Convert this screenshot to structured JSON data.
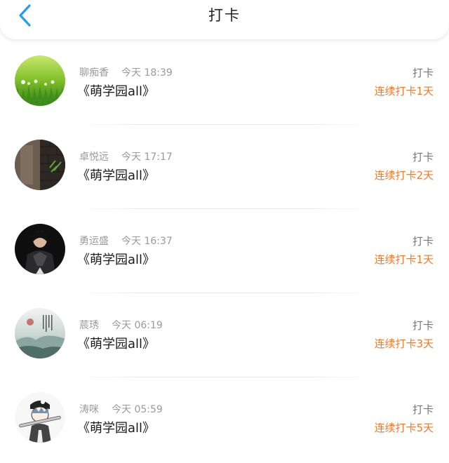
{
  "header": {
    "title": "打卡",
    "back_icon": "chevron-left-icon",
    "accent_color": "#2b9bf0"
  },
  "checkins": [
    {
      "user": "聊痴香",
      "time": "今天 18:39",
      "group": "《萌学园all》",
      "action": "打卡",
      "streak": "连续打卡1天",
      "avatar": "grass-avatar"
    },
    {
      "user": "卓悦远",
      "time": "今天 17:17",
      "group": "《萌学园all》",
      "action": "打卡",
      "streak": "连续打卡2天",
      "avatar": "brick-wall-avatar"
    },
    {
      "user": "勇运盛",
      "time": "今天 16:37",
      "group": "《萌学园all》",
      "action": "打卡",
      "streak": "连续打卡1天",
      "avatar": "dark-figure-avatar"
    },
    {
      "user": "莀琇",
      "time": "今天 06:19",
      "group": "《萌学园all》",
      "action": "打卡",
      "streak": "连续打卡3天",
      "avatar": "ink-landscape-avatar"
    },
    {
      "user": "涛咪",
      "time": "今天 05:59",
      "group": "《萌学园all》",
      "action": "打卡",
      "streak": "连续打卡5天",
      "avatar": "anime-boy-avatar"
    }
  ],
  "colors": {
    "streak": "#f07b2f",
    "meta": "#9a9a9a"
  }
}
